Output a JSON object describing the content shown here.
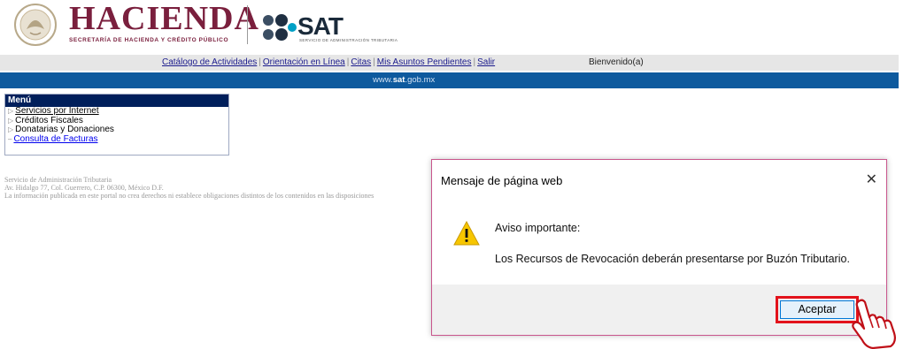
{
  "header": {
    "hacienda_title": "HACIENDA",
    "hacienda_subtitle": "SECRETARÍA DE HACIENDA Y CRÉDITO PÚBLICO",
    "sat_title": "SAT",
    "sat_subtitle": "SERVICIO DE ADMINISTRACIÓN TRIBUTARIA"
  },
  "nav": {
    "links": [
      "Catálogo de Actividades",
      "Orientación en Línea",
      "Citas",
      "Mis Asuntos Pendientes",
      "Salir"
    ],
    "welcome": "Bienvenido(a)"
  },
  "banner": {
    "prefix": "www.",
    "brand": "sat",
    "suffix": ".gob.mx"
  },
  "menu": {
    "title": "Menú",
    "items": [
      {
        "label": "Servicios por Internet",
        "icon": "triangle-right-icon"
      },
      {
        "label": "Créditos Fiscales",
        "icon": "triangle-right-icon"
      },
      {
        "label": "Donatarias y Donaciones",
        "icon": "triangle-right-icon"
      },
      {
        "label": "Consulta de Facturas",
        "icon": "dash-icon"
      }
    ]
  },
  "footer": {
    "line1": "Servicio de Administración Tributaria",
    "line2": "Av. Hidalgo 77, Col. Guerrero, C.P. 06300, México D.F.",
    "line3": "La información publicada en este portal no crea derechos ni establece obligaciones distintos de los contenidos en las disposiciones"
  },
  "dialog": {
    "title": "Mensaje de página web",
    "heading": "Aviso importante:",
    "message": "Los Recursos de Revocación deberán presentarse por Buzón Tributario.",
    "ok_label": "Aceptar",
    "close_icon": "close-icon",
    "warning_icon": "warning-icon"
  },
  "colors": {
    "hacienda": "#7a1f3d",
    "banner_blue": "#0e5a9e",
    "menu_header": "#001f5b",
    "highlight_red": "#e3121b"
  }
}
